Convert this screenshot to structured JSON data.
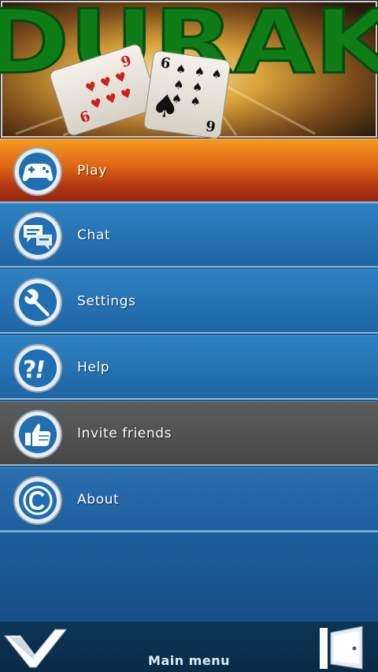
{
  "banner": {
    "logo_text": "DURAK",
    "cards": [
      {
        "suit": "hearts",
        "rank_top": "6",
        "rank_bottom": "6"
      },
      {
        "suit": "spades",
        "rank_top": "6",
        "rank_bottom": "9"
      }
    ]
  },
  "menu": {
    "items": [
      {
        "label": "Play",
        "icon": "gamepad-icon",
        "state": "selected"
      },
      {
        "label": "Chat",
        "icon": "chat-bubbles-icon"
      },
      {
        "label": "Settings",
        "icon": "wrench-icon"
      },
      {
        "label": "Help",
        "icon": "question-exclamation-icon"
      },
      {
        "label": "Invite friends",
        "icon": "thumbs-up-icon",
        "state": "highlighted"
      },
      {
        "label": "About",
        "icon": "copyright-icon"
      }
    ]
  },
  "bottom_bar": {
    "title": "Main menu",
    "left_icon": "checkmark-icon",
    "right_icon": "exit-door-icon"
  },
  "colors": {
    "selected_accent": "#dd6314",
    "menu_blue": "#2773b2",
    "highlight_gray": "#525252",
    "logo_green": "#0f7d17"
  }
}
